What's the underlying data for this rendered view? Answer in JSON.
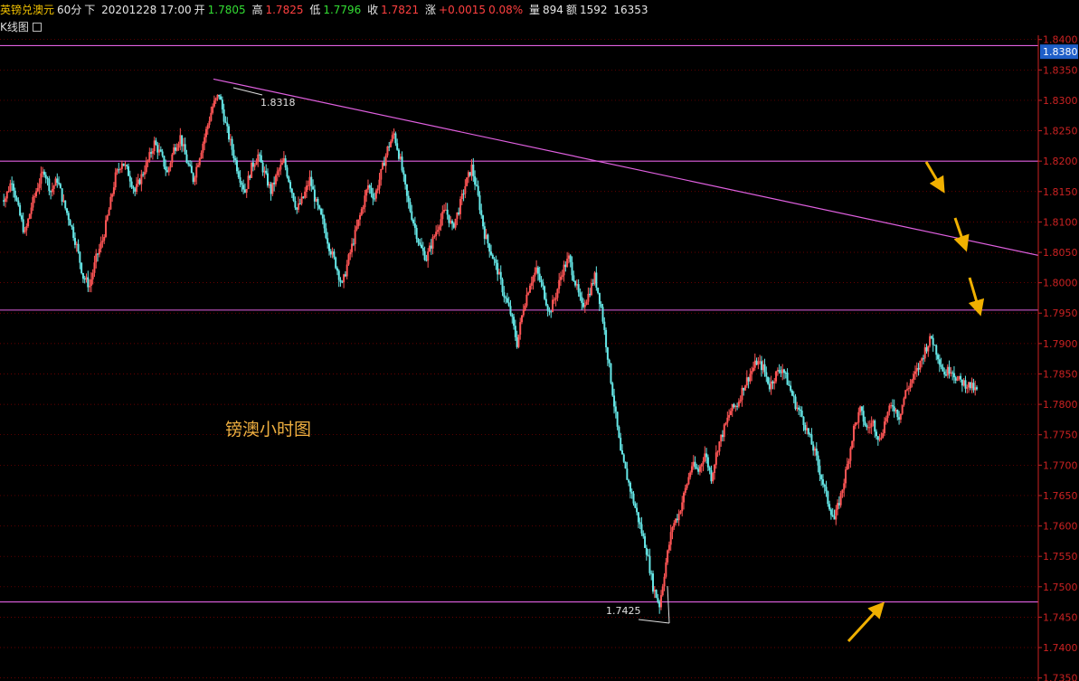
{
  "header": {
    "symbol": "英镑兑澳元",
    "period": "60分",
    "direction_label": "下",
    "datetime": "20201228 17:00",
    "open_label": "开",
    "open": "1.7805",
    "high_label": "高",
    "high": "1.7825",
    "low_label": "低",
    "low": "1.7796",
    "close_label": "收",
    "close": "1.7821",
    "change_label": "涨",
    "change": "+0.0015",
    "change_pct": "0.08%",
    "volume_label": "量",
    "volume": "894",
    "amount_label": "额",
    "amount": "1592",
    "extra": "16353"
  },
  "subheader": {
    "label": "K线图"
  },
  "colors": {
    "background": "#000000",
    "up_candle": "#ff5555",
    "down_candle": "#66e8e8",
    "grid": "#8a0000",
    "axis_text": "#cc2222",
    "trend_line": "#e060e0",
    "arrow": "#f0b000",
    "annotation": "#f0b040"
  },
  "chart_data": {
    "type": "candlestick",
    "title": "",
    "annotation_text": "镑澳小时图",
    "y_axis": {
      "ylim": [
        1.7345,
        1.8407
      ],
      "ticks": [
        "1.8400",
        "1.8350",
        "1.8300",
        "1.8250",
        "1.8200",
        "1.8150",
        "1.8100",
        "1.8050",
        "1.8000",
        "1.7950",
        "1.7900",
        "1.7850",
        "1.7800",
        "1.7750",
        "1.7700",
        "1.7650",
        "1.7600",
        "1.7550",
        "1.7500",
        "1.7450",
        "1.7400",
        "1.7350"
      ],
      "current_price_tag": "1.8380"
    },
    "high_label": "1.8318",
    "low_label": "1.7425",
    "horizontal_levels": [
      1.839,
      1.82,
      1.7955,
      1.7475
    ],
    "trend_line": {
      "from": [
        0.0,
        1.8335
      ],
      "to": [
        1.0,
        1.8045
      ]
    },
    "closes": [
      1.814,
      1.817,
      1.812,
      1.808,
      1.8125,
      1.816,
      1.8185,
      1.815,
      1.817,
      1.813,
      1.81,
      1.806,
      1.801,
      1.7995,
      1.804,
      1.807,
      1.812,
      1.8175,
      1.82,
      1.818,
      1.815,
      1.8175,
      1.82,
      1.823,
      1.821,
      1.818,
      1.822,
      1.824,
      1.82,
      1.817,
      1.821,
      1.825,
      1.829,
      1.831,
      1.826,
      1.822,
      1.818,
      1.815,
      1.819,
      1.821,
      1.818,
      1.815,
      1.818,
      1.82,
      1.816,
      1.812,
      1.814,
      1.817,
      1.813,
      1.81,
      1.806,
      1.803,
      1.7995,
      1.804,
      1.808,
      1.812,
      1.816,
      1.814,
      1.818,
      1.822,
      1.8245,
      1.82,
      1.814,
      1.81,
      1.806,
      1.804,
      1.807,
      1.81,
      1.812,
      1.809,
      1.812,
      1.816,
      1.819,
      1.814,
      1.808,
      1.805,
      1.802,
      1.798,
      1.795,
      1.79,
      1.796,
      1.8,
      1.802,
      1.799,
      1.795,
      1.798,
      1.802,
      1.804,
      1.8,
      1.796,
      1.798,
      1.801,
      1.796,
      1.788,
      1.78,
      1.772,
      1.768,
      1.764,
      1.76,
      1.756,
      1.75,
      1.747,
      1.754,
      1.76,
      1.762,
      1.766,
      1.77,
      1.769,
      1.772,
      1.768,
      1.773,
      1.776,
      1.779,
      1.78,
      1.783,
      1.785,
      1.787,
      1.786,
      1.783,
      1.785,
      1.786,
      1.783,
      1.78,
      1.778,
      1.775,
      1.772,
      1.768,
      1.764,
      1.761,
      1.765,
      1.77,
      1.776,
      1.779,
      1.776,
      1.777,
      1.774,
      1.778,
      1.78,
      1.778,
      1.782,
      1.784,
      1.786,
      1.789,
      1.791,
      1.788,
      1.785,
      1.786,
      1.784,
      1.7835,
      1.783,
      1.7821
    ]
  }
}
